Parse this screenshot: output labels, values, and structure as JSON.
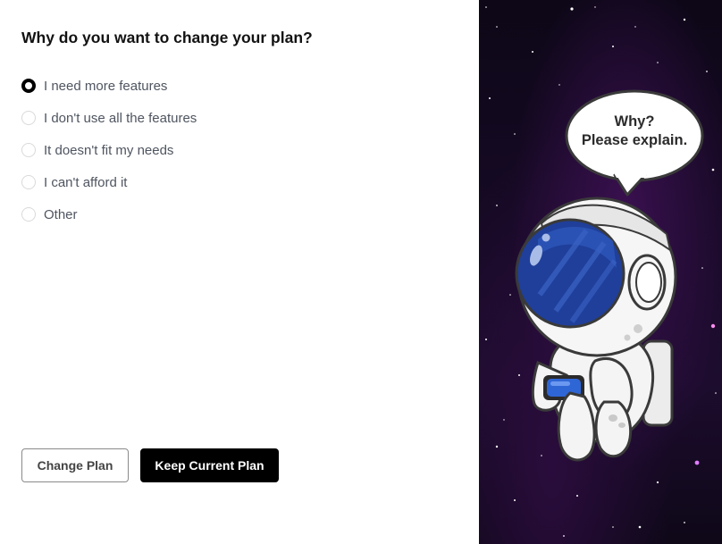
{
  "form": {
    "title": "Why do you want to change your plan?",
    "options": [
      {
        "label": "I need more features",
        "checked": true
      },
      {
        "label": "I don't use all the features",
        "checked": false
      },
      {
        "label": "It doesn't fit my needs",
        "checked": false
      },
      {
        "label": "I can't afford it",
        "checked": false
      },
      {
        "label": "Other",
        "checked": false
      }
    ]
  },
  "buttons": {
    "change_plan": "Change Plan",
    "keep_plan": "Keep Current Plan"
  },
  "illustration": {
    "bubble_line1": "Why?",
    "bubble_line2": "Please explain.",
    "icon": "astronaut-illustration"
  },
  "colors": {
    "primary": "#000000",
    "radio_border": "#d9d9d9",
    "space_bg": "#170a26",
    "visor": "#1f3f9a",
    "badge": "#2f66d6"
  }
}
